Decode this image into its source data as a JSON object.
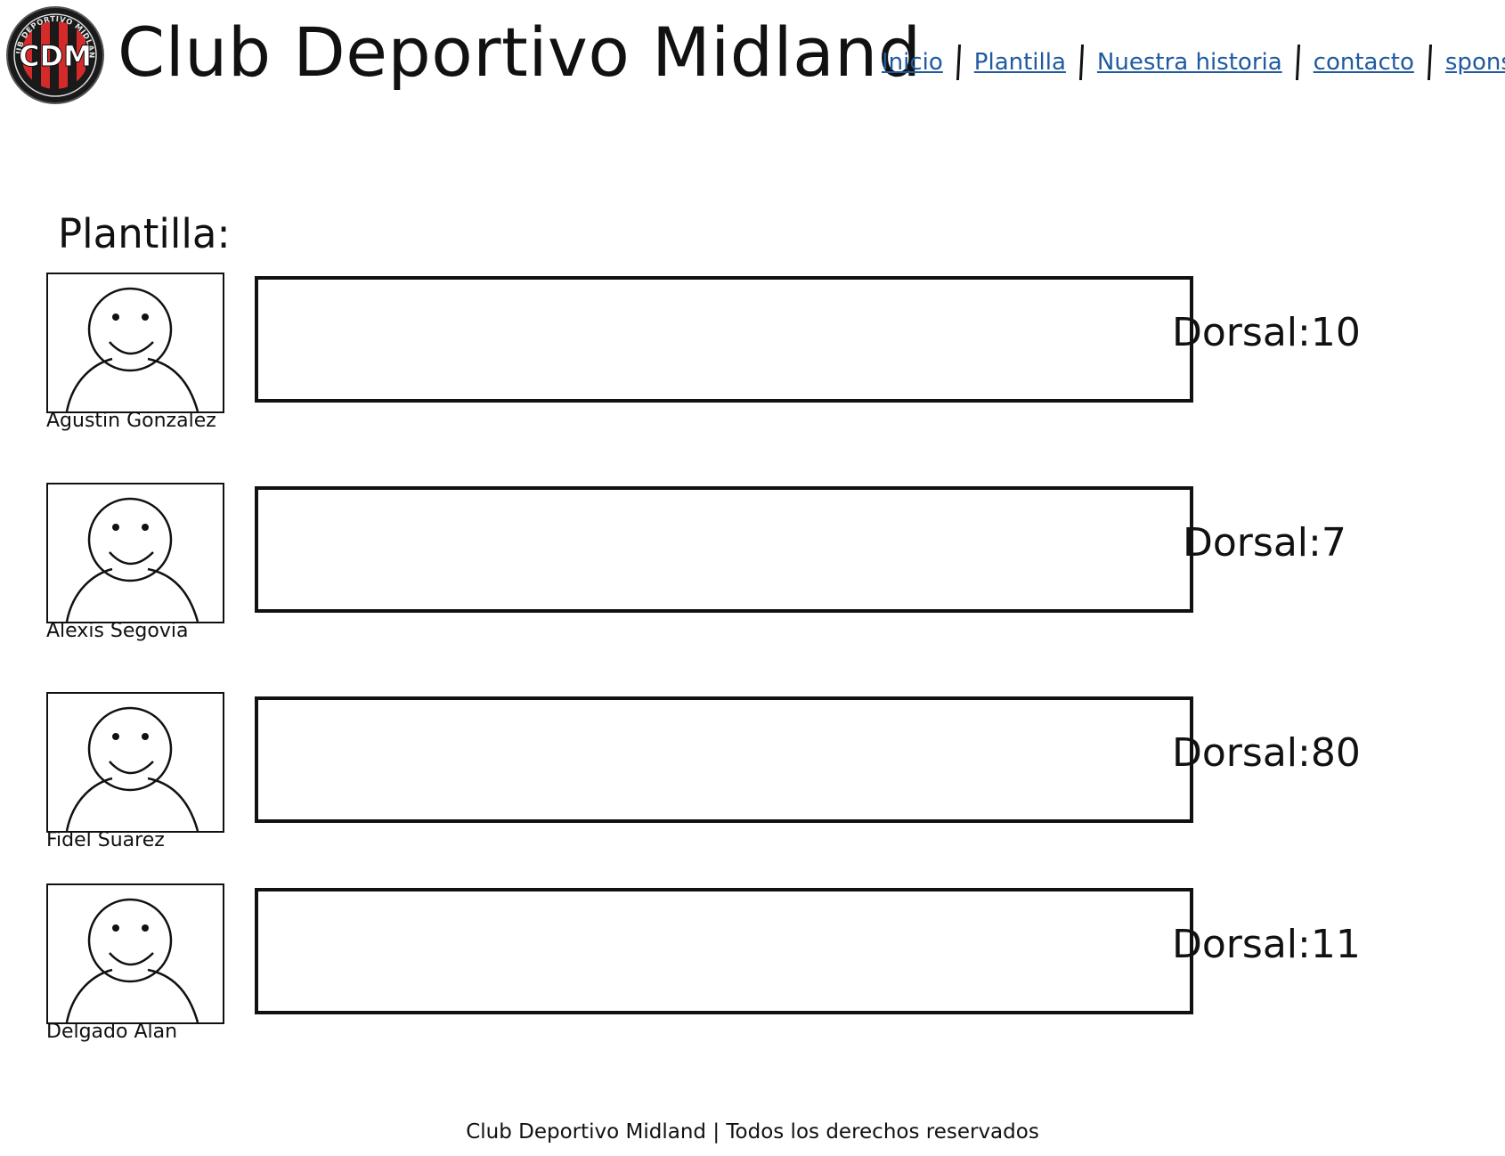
{
  "header": {
    "logo_text": "CDM",
    "logo_ring_text": "CLUB DEPORTIVO MIDLAND",
    "title": "Club Deportivo Midland",
    "nav": [
      "Inicio",
      "Plantilla",
      "Nuestra historia",
      "contacto",
      "sponsors"
    ]
  },
  "main": {
    "section_title": "Plantilla:",
    "players": [
      {
        "name": "Agustin Gonzalez",
        "dorsal": "Dorsal:10"
      },
      {
        "name": "Alexis Segovia",
        "dorsal": "Dorsal:7"
      },
      {
        "name": "Fidel Suarez",
        "dorsal": "Dorsal:80"
      },
      {
        "name": "Delgado Alan",
        "dorsal": "Dorsal:11"
      }
    ]
  },
  "footer": {
    "text": "Club Deportivo Midland | Todos los derechos reservados"
  },
  "colors": {
    "link": "#1f5aa0",
    "logo_red": "#d42a2a",
    "logo_dark": "#1a1a1a"
  }
}
